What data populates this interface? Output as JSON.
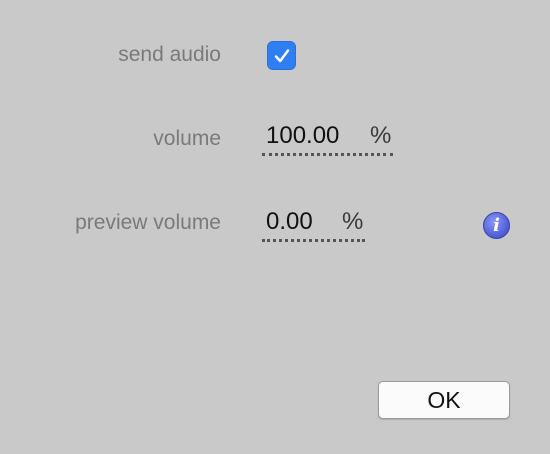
{
  "send_audio": {
    "label": "send audio",
    "checked": true
  },
  "volume": {
    "label": "volume",
    "value": "100.00",
    "unit": "%"
  },
  "preview_volume": {
    "label": "preview volume",
    "value": "0.00",
    "unit": "%"
  },
  "info_icon": {
    "glyph": "i",
    "icon": "info-icon"
  },
  "ok_button": {
    "label": "OK"
  },
  "colors": {
    "background": "#c9c9c9",
    "checkbox_accent": "#2f7ff3",
    "info_icon": "#4d5bd6"
  }
}
